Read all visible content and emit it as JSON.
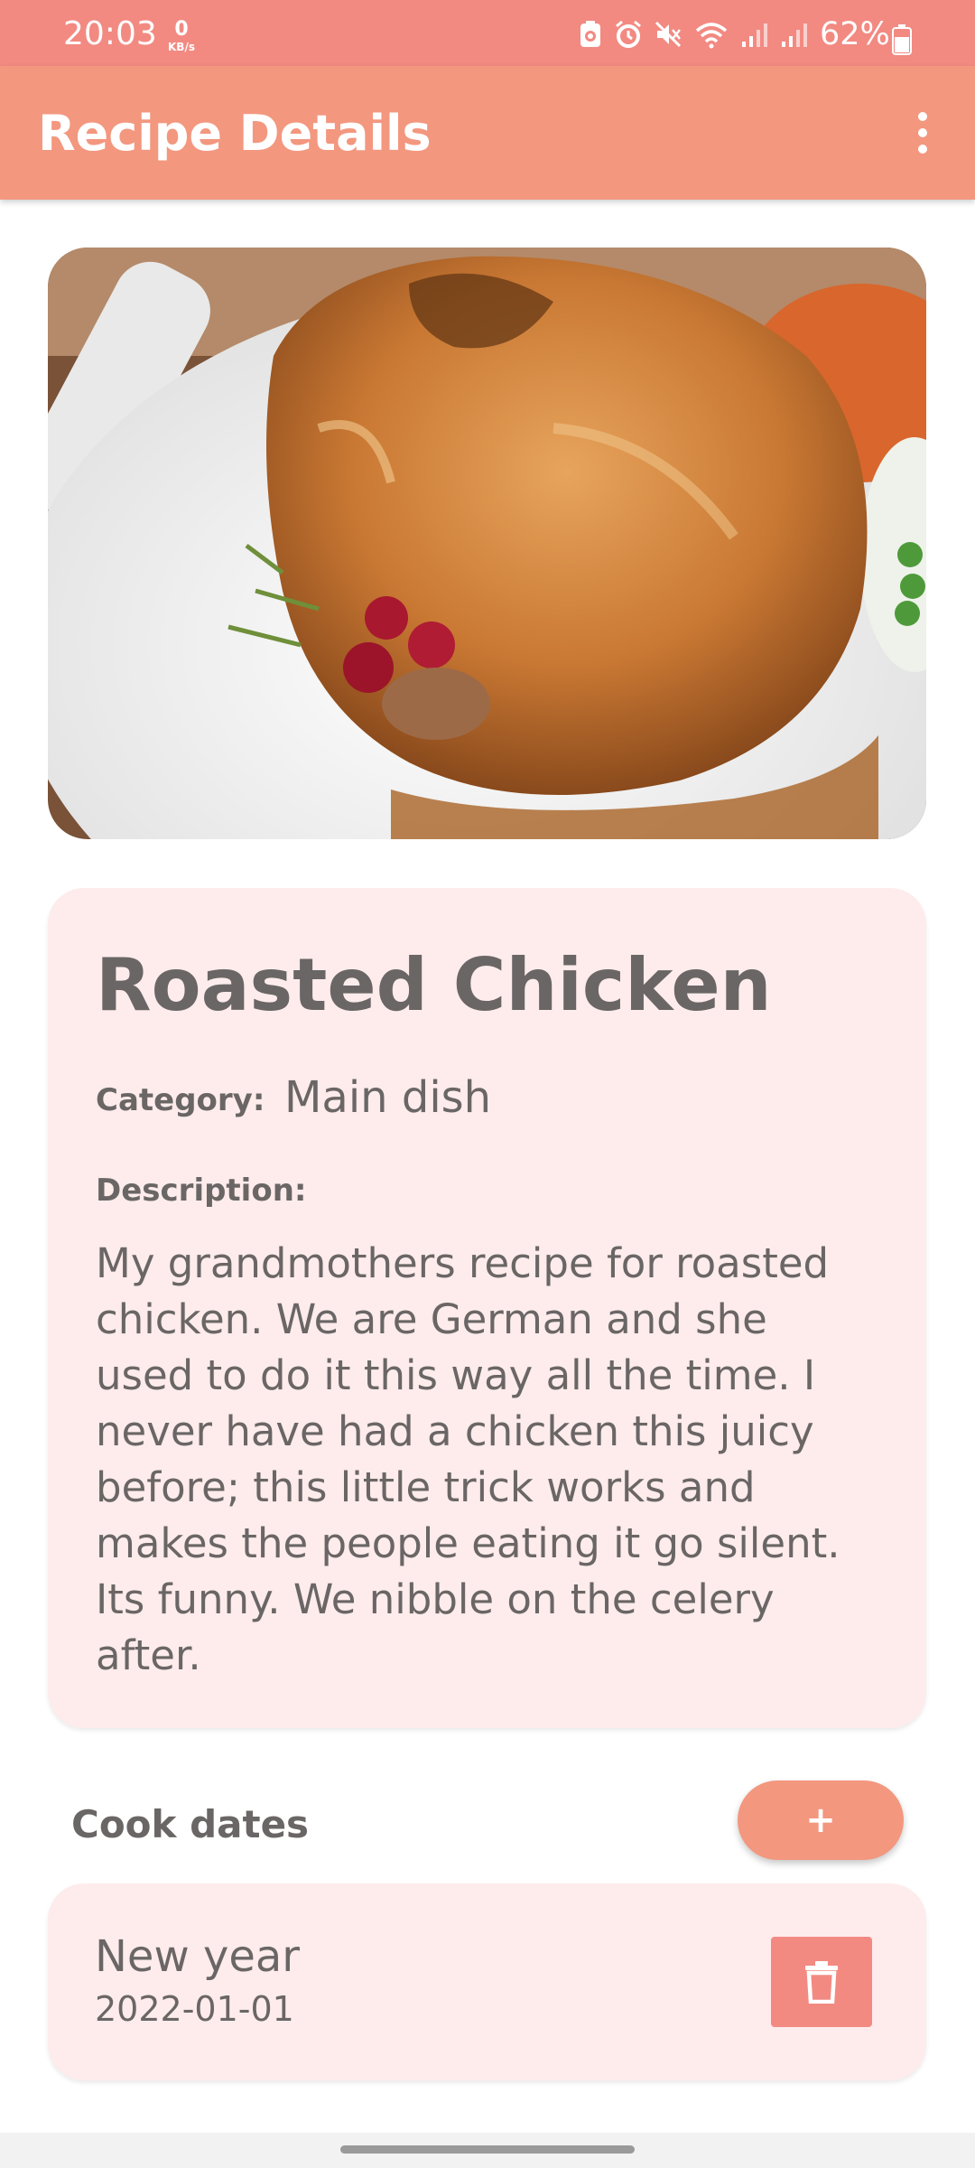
{
  "status_bar": {
    "time": "20:03",
    "network_speed_value": "0",
    "network_speed_unit": "KB/s",
    "battery_percent": "62%",
    "icons": [
      "battery-saver-icon",
      "alarm-icon",
      "mute-icon",
      "wifi-icon",
      "signal-icon",
      "signal-icon-2",
      "battery-icon"
    ]
  },
  "app_bar": {
    "title": "Recipe Details",
    "menu_icon": "more-vert-icon"
  },
  "recipe": {
    "image_icon": "roasted-chicken-photo",
    "title": "Roasted Chicken",
    "category_label": "Category:",
    "category_value": "Main dish",
    "description_label": "Description:",
    "description": "My grandmothers recipe for roasted chicken. We are German and she used to do it this way all the time. I never have had a chicken this juicy before; this little trick works and makes the people eating it go silent. Its funny. We nibble on the celery after."
  },
  "cook_dates": {
    "label": "Cook dates",
    "add_button_label": "+",
    "items": [
      {
        "name": "New year",
        "date": "2022-01-01",
        "delete_icon": "trash-icon"
      }
    ]
  },
  "colors": {
    "status_bar": "#f28a82",
    "app_bar": "#f3977f",
    "card_background": "#feecec",
    "text": "#6b6666",
    "delete_button": "#f28a82"
  }
}
